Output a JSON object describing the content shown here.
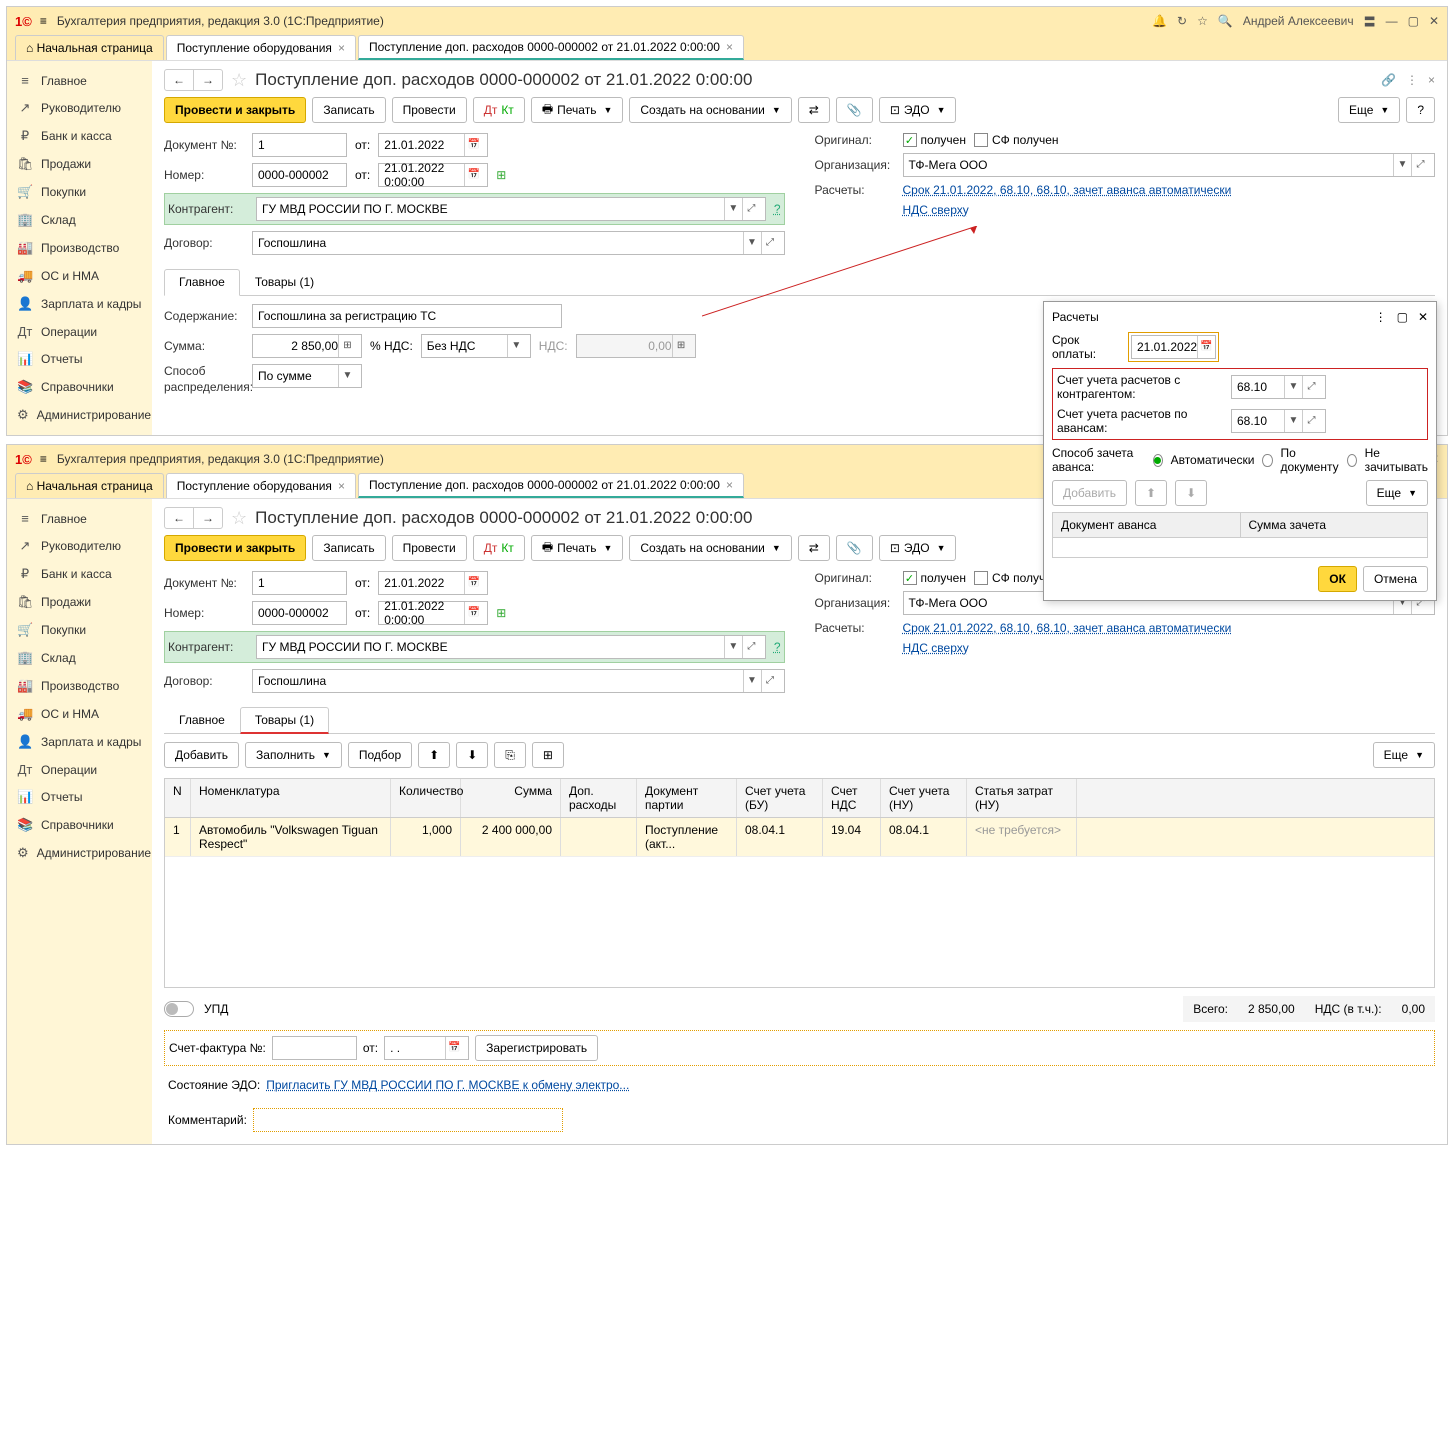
{
  "common": {
    "app_title": "Бухгалтерия предприятия, редакция 3.0  (1С:Предприятие)",
    "user": "Андрей Алексеевич",
    "logo_text": "1©",
    "tab_home": "Начальная страница",
    "tab1": "Поступление оборудования",
    "tab2": "Поступление доп. расходов 0000-000002 от 21.01.2022 0:00:00",
    "sidebar": [
      {
        "icon": "≡",
        "label": "Главное"
      },
      {
        "icon": "↗",
        "label": "Руководителю"
      },
      {
        "icon": "₽",
        "label": "Банк и касса"
      },
      {
        "icon": "🛍",
        "label": "Продажи"
      },
      {
        "icon": "🛒",
        "label": "Покупки"
      },
      {
        "icon": "🏢",
        "label": "Склад"
      },
      {
        "icon": "🏭",
        "label": "Производство"
      },
      {
        "icon": "🚚",
        "label": "ОС и НМА"
      },
      {
        "icon": "👤",
        "label": "Зарплата и кадры"
      },
      {
        "icon": "Дт",
        "label": "Операции"
      },
      {
        "icon": "📊",
        "label": "Отчеты"
      },
      {
        "icon": "📚",
        "label": "Справочники"
      },
      {
        "icon": "⚙",
        "label": "Администрирование"
      }
    ],
    "doc_title": "Поступление доп. расходов 0000-000002 от 21.01.2022 0:00:00",
    "btn_post_close": "Провести и закрыть",
    "btn_save": "Записать",
    "btn_post": "Провести",
    "btn_print": "Печать",
    "btn_create_basis": "Создать на основании",
    "btn_edo": "ЭДО",
    "btn_more": "Еще",
    "lbl_doc_no": "Документ №:",
    "doc_no": "1",
    "lbl_from": "от:",
    "doc_date": "21.01.2022",
    "lbl_number": "Номер:",
    "number": "0000-000002",
    "number_datetime": "21.01.2022  0:00:00",
    "lbl_counterparty": "Контрагент:",
    "counterparty": "ГУ МВД РОССИИ ПО Г. МОСКВЕ",
    "lbl_contract": "Договор:",
    "contract": "Госпошлина",
    "lbl_original": "Оригинал:",
    "chk_received": "получен",
    "chk_sf_received": "СФ получен",
    "lbl_org": "Организация:",
    "org": "ТФ-Мега ООО",
    "lbl_calc": "Расчеты:",
    "calc_link": "Срок 21.01.2022, 68.10, 68.10, зачет аванса автоматически",
    "nds_link": "НДС сверху",
    "tab_main": "Главное",
    "tab_goods": "Товары (1)",
    "lbl_content": "Содержание:",
    "content_val": "Госпошлина за регистрацию ТС",
    "lbl_sum": "Сумма:",
    "sum_val": "2 850,00",
    "lbl_pct_nds": "% НДС:",
    "pct_nds_val": "Без НДС",
    "lbl_nds": "НДС:",
    "nds_val": "0,00",
    "lbl_dist": "Способ распределения:",
    "dist_val": "По сумме"
  },
  "popup": {
    "title": "Расчеты",
    "lbl_due": "Срок оплаты:",
    "due_val": "21.01.2022",
    "lbl_acc_cp": "Счет учета расчетов с контрагентом:",
    "acc_cp_val": "68.10",
    "lbl_acc_adv": "Счет учета расчетов по авансам:",
    "acc_adv_val": "68.10",
    "lbl_adv_method": "Способ зачета аванса:",
    "opt_auto": "Автоматически",
    "opt_bydoc": "По документу",
    "opt_none": "Не зачитывать",
    "btn_add": "Добавить",
    "btn_more": "Еще",
    "th_doc": "Документ аванса",
    "th_amount": "Сумма зачета",
    "btn_ok": "ОК",
    "btn_cancel": "Отмена"
  },
  "goods": {
    "btn_add": "Добавить",
    "btn_fill": "Заполнить",
    "btn_pick": "Подбор",
    "th_n": "N",
    "th_nom": "Номенклатура",
    "th_qty": "Количество",
    "th_sum": "Сумма",
    "th_extra": "Доп. расходы",
    "th_batch": "Документ партии",
    "th_acc_bu": "Счет учета (БУ)",
    "th_acc_nds": "Счет НДС",
    "th_acc_nu": "Счет учета (НУ)",
    "th_cost": "Статья затрат (НУ)",
    "row": {
      "n": "1",
      "nom": "Автомобиль \"Volkswagen Tiguan Respect\"",
      "qty": "1,000",
      "sum": "2 400 000,00",
      "extra": "",
      "batch": "Поступление (акт...",
      "acc_bu": "08.04.1",
      "acc_nds": "19.04",
      "acc_nu": "08.04.1",
      "cost": "<не требуется>"
    },
    "upd": "УПД",
    "lbl_total": "Всего:",
    "total_val": "2 850,00",
    "lbl_nds_total": "НДС (в т.ч.):",
    "nds_total_val": "0,00",
    "lbl_sf": "Счет-фактура №:",
    "btn_register": "Зарегистрировать",
    "lbl_edo_state": "Состояние ЭДО:",
    "edo_state_link": "Пригласить ГУ МВД РОССИИ ПО Г. МОСКВЕ к обмену электро...",
    "lbl_comment": "Комментарий:"
  }
}
